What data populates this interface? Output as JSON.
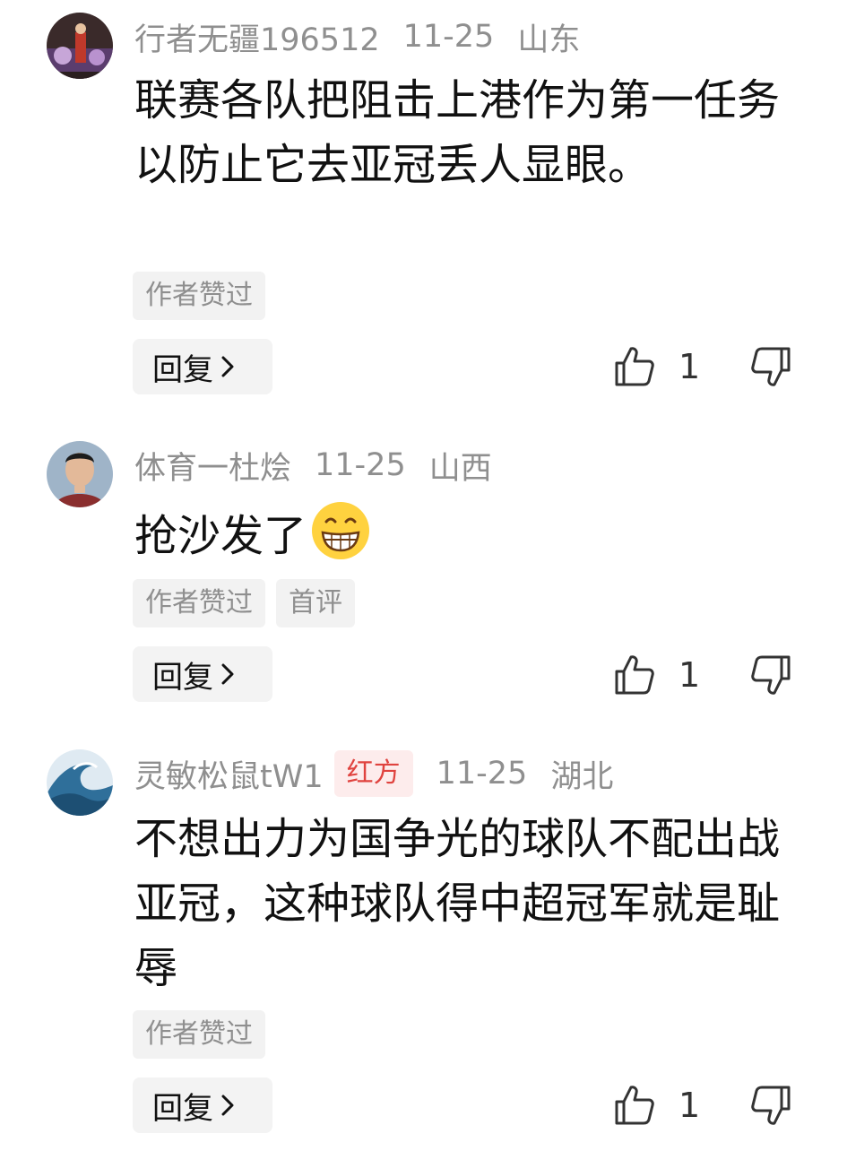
{
  "comments": [
    {
      "username": "行者无疆196512",
      "date": "11-25",
      "location": "山东",
      "text": "联赛各队把阻击上港作为第一任务以防止它去亚冠丢人显眼。",
      "badges": [
        "作者赞过"
      ],
      "reply_label": "回复",
      "like_count": "1",
      "avatar_icon": "performer-photo-avatar"
    },
    {
      "username": "体育一杜烩",
      "date": "11-25",
      "location": "山西",
      "text": "抢沙发了",
      "emoji": "grinning-face-emoji",
      "badges": [
        "作者赞过",
        "首评"
      ],
      "reply_label": "回复",
      "like_count": "1",
      "avatar_icon": "portrait-photo-avatar"
    },
    {
      "username": "灵敏松鼠tW1",
      "tag": "红方",
      "date": "11-25",
      "location": "湖北",
      "text": "不想出力为国争光的球队不配出战亚冠，这种球队得中超冠军就是耻辱",
      "badges": [
        "作者赞过"
      ],
      "reply_label": "回复",
      "like_count": "1",
      "avatar_icon": "ocean-wave-avatar"
    }
  ],
  "colors": {
    "meta_gray": "#8f8f8f",
    "tag_red": "#e0433f",
    "tag_red_bg": "#fdecec",
    "badge_bg": "#f2f2f2"
  }
}
